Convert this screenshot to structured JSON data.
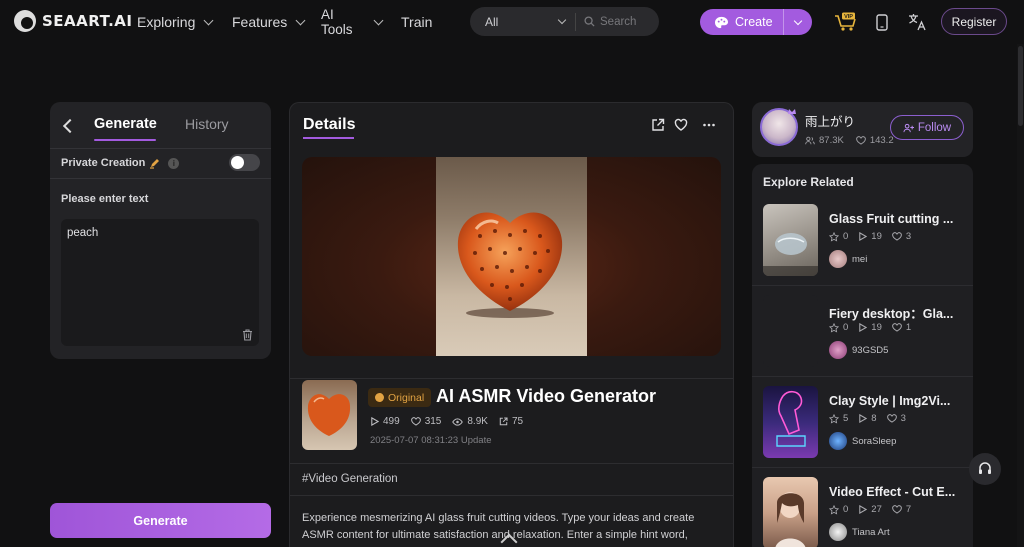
{
  "brand": {
    "name": "SEAART.AI"
  },
  "nav": {
    "exploring": "Exploring",
    "features": "Features",
    "ai_tools_line1": "AI",
    "ai_tools_line2": "Tools",
    "train": "Train"
  },
  "search": {
    "scope": "All",
    "placeholder": "Search"
  },
  "header": {
    "create_label": "Create",
    "vip_label": "VIP",
    "register_label": "Register"
  },
  "left_panel": {
    "tab_generate": "Generate",
    "tab_history": "History",
    "private_creation_label": "Private Creation",
    "private_creation_enabled": false,
    "prompt_label": "Please enter text",
    "prompt_value": "peach",
    "generate_label": "Generate"
  },
  "details": {
    "title": "Details",
    "badge": "Original",
    "tool_title": "AI ASMR Video Generator",
    "stats": {
      "runs": "499",
      "likes": "315",
      "views": "8.9K",
      "shares": "75"
    },
    "updated": "2025-07-07 08:31:23 Update",
    "tag": "#Video Generation",
    "description": "Experience mesmerizing AI glass fruit cutting videos. Type your ideas and create ASMR content for ultimate satisfaction and relaxation. Enter a simple hint word,"
  },
  "creator": {
    "name": "雨上がり",
    "followers": "87.3K",
    "likes": "143.2",
    "follow_label": "Follow"
  },
  "explore": {
    "title": "Explore Related",
    "items": [
      {
        "title": "Glass Fruit cutting ...",
        "stars": "0",
        "runs": "19",
        "likes": "3",
        "author": "mei"
      },
      {
        "title": "Fiery desktop：Gla...",
        "stars": "0",
        "runs": "19",
        "likes": "1",
        "author": "93GSD5"
      },
      {
        "title": "Clay Style | Img2Vi...",
        "stars": "5",
        "runs": "8",
        "likes": "3",
        "author": "SoraSleep"
      },
      {
        "title": "Video Effect - Cut E...",
        "stars": "0",
        "runs": "27",
        "likes": "7",
        "author": "Tiana Art"
      }
    ]
  },
  "colors": {
    "accent": "#a35bdf",
    "badge": "#e2a343",
    "background": "#111112"
  }
}
